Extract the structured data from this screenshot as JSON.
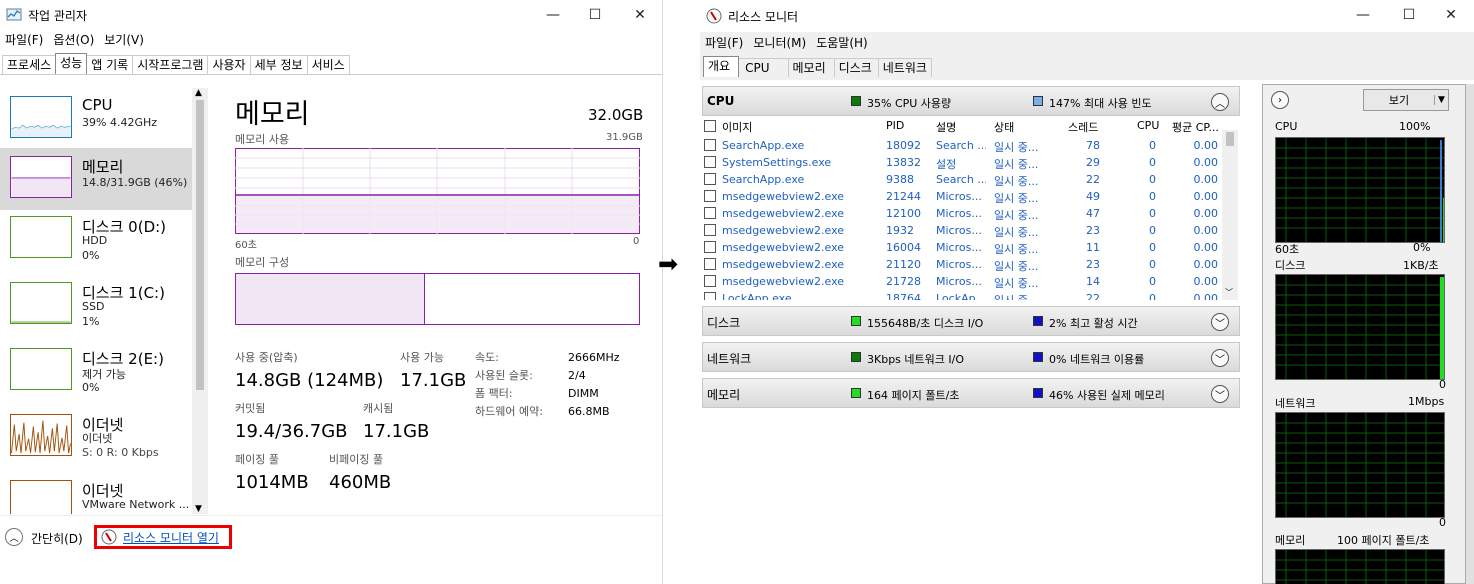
{
  "tm": {
    "title": "작업 관리자",
    "menu": [
      "파일(F)",
      "옵션(O)",
      "보기(V)"
    ],
    "tabs": [
      "프로세스",
      "성능",
      "앱 기록",
      "시작프로그램",
      "사용자",
      "세부 정보",
      "서비스"
    ],
    "sidebar": [
      {
        "title": "CPU",
        "line1": "39% 4.42GHz",
        "line2": ""
      },
      {
        "title": "메모리",
        "line1": "14.8/31.9GB (46%)",
        "line2": ""
      },
      {
        "title": "디스크 0(D:)",
        "line1": "HDD",
        "line2": "0%"
      },
      {
        "title": "디스크 1(C:)",
        "line1": "SSD",
        "line2": "1%"
      },
      {
        "title": "디스크 2(E:)",
        "line1": "제거 가능",
        "line2": "0%"
      },
      {
        "title": "이더넷",
        "line1": "이더넷",
        "line2": "S: 0 R: 0 Kbps"
      },
      {
        "title": "이더넷",
        "line1": "VMware Network ...",
        "line2": ""
      }
    ],
    "main": {
      "title": "메모리",
      "total": "32.0GB",
      "usage_label": "메모리 사용",
      "usage_max": "31.9GB",
      "axis_left": "60초",
      "axis_right": "0",
      "composition_label": "메모리 구성",
      "stats": {
        "in_use_label": "사용 중(압축)",
        "in_use": "14.8GB (124MB)",
        "available_label": "사용 가능",
        "available": "17.1GB",
        "committed_label": "커밋됨",
        "committed": "19.4/36.7GB",
        "cached_label": "캐시됨",
        "cached": "17.1GB",
        "paged_label": "페이징 풀",
        "paged": "1014MB",
        "nonpaged_label": "비페이징 풀",
        "nonpaged": "460MB"
      },
      "props": [
        {
          "k": "속도:",
          "v": "2666MHz"
        },
        {
          "k": "사용된 슬롯:",
          "v": "2/4"
        },
        {
          "k": "폼 팩터:",
          "v": "DIMM"
        },
        {
          "k": "하드웨어 예약:",
          "v": "66.8MB"
        }
      ]
    },
    "footer": {
      "simple": "간단히(D)",
      "open_rm": "리소스 모니터 열기"
    }
  },
  "rm": {
    "title": "리소스 모니터",
    "menu": [
      "파일(F)",
      "모니터(M)",
      "도움말(H)"
    ],
    "tabs": [
      "개요",
      "CPU",
      "메모리",
      "디스크",
      "네트워크"
    ],
    "cpu": {
      "name": "CPU",
      "usage": "35% CPU 사용량",
      "freq": "147% 최대 사용 빈도",
      "columns": [
        "이미지",
        "PID",
        "설명",
        "상태",
        "스레드",
        "CPU",
        "평균 CP..."
      ],
      "rows": [
        [
          "SearchApp.exe",
          "18092",
          "Search ...",
          "일시 중...",
          "78",
          "0",
          "0.00"
        ],
        [
          "SystemSettings.exe",
          "13832",
          "설정",
          "일시 중...",
          "29",
          "0",
          "0.00"
        ],
        [
          "SearchApp.exe",
          "9388",
          "Search ...",
          "일시 중...",
          "22",
          "0",
          "0.00"
        ],
        [
          "msedgewebview2.exe",
          "21244",
          "Micros...",
          "일시 중...",
          "49",
          "0",
          "0.00"
        ],
        [
          "msedgewebview2.exe",
          "12100",
          "Micros...",
          "일시 중...",
          "47",
          "0",
          "0.00"
        ],
        [
          "msedgewebview2.exe",
          "1932",
          "Micros...",
          "일시 중...",
          "23",
          "0",
          "0.00"
        ],
        [
          "msedgewebview2.exe",
          "16004",
          "Micros...",
          "일시 중...",
          "11",
          "0",
          "0.00"
        ],
        [
          "msedgewebview2.exe",
          "21120",
          "Micros...",
          "일시 중...",
          "23",
          "0",
          "0.00"
        ],
        [
          "msedgewebview2.exe",
          "21728",
          "Micros...",
          "일시 중...",
          "14",
          "0",
          "0.00"
        ],
        [
          "LockApp.exe",
          "18764",
          "LockAp...",
          "일시 중...",
          "22",
          "0",
          "0.00"
        ]
      ]
    },
    "disk": {
      "name": "디스크",
      "io": "155648B/초 디스크 I/O",
      "active": "2% 최고 활성 시간"
    },
    "net": {
      "name": "네트워크",
      "io": "3Kbps 네트워크 I/O",
      "use": "0% 네트워크 이용률"
    },
    "mem": {
      "name": "메모리",
      "faults": "164 페이지 폴트/초",
      "used": "46% 사용된 실제 메모리"
    },
    "graphs": {
      "view_btn": "보기",
      "cpu": {
        "label": "CPU",
        "max": "100%",
        "xl": "60초",
        "min": "0%"
      },
      "disk": {
        "label": "디스크",
        "max": "1KB/초",
        "min": "0"
      },
      "net": {
        "label": "네트워크",
        "max": "1Mbps",
        "min": "0"
      },
      "mem": {
        "label": "메모리",
        "max": "100 페이지 폴트/초"
      }
    }
  },
  "colors": {
    "memory_purple": "#8b1fa8",
    "cpu_blue": "#1a7ab8",
    "disk_green": "#4d9a1f",
    "eth_orange": "#a0520e",
    "link_blue": "#0050c0",
    "alert_red": "#e00000"
  }
}
